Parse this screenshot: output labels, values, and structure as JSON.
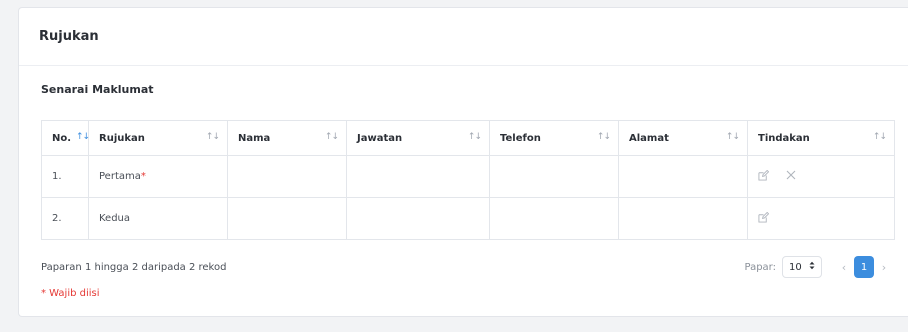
{
  "card": {
    "title": "Rujukan"
  },
  "section": {
    "title": "Senarai Maklumat"
  },
  "table": {
    "columns": [
      "No.",
      "Rujukan",
      "Nama",
      "Jawatan",
      "Telefon",
      "Alamat",
      "Tindakan"
    ],
    "rows": [
      {
        "no": "1.",
        "rujukan": "Pertama",
        "required_mark": "*",
        "nama": "",
        "jawatan": "",
        "telefon": "",
        "alamat": "",
        "actions": [
          "edit-icon",
          "close-icon"
        ]
      },
      {
        "no": "2.",
        "rujukan": "Kedua",
        "required_mark": "",
        "nama": "",
        "jawatan": "",
        "telefon": "",
        "alamat": "",
        "actions": [
          "edit-icon"
        ]
      }
    ],
    "sort_icon": "↑↓"
  },
  "footer": {
    "info": "Paparan 1 hingga 2 daripada 2 rekod",
    "required_note": "* Wajib diisi"
  },
  "pagination": {
    "label": "Papar:",
    "page_size": "10",
    "prev": "‹",
    "current_page": "1",
    "next": "›"
  },
  "colors": {
    "accent": "#3c8dde",
    "required": "#e53935"
  }
}
